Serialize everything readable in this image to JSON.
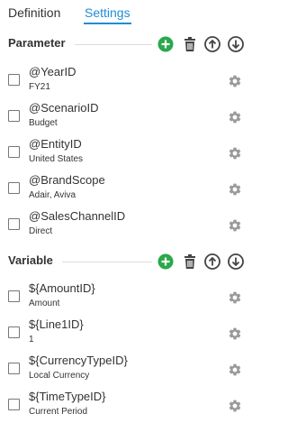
{
  "tabs": [
    {
      "label": "Definition",
      "active": false
    },
    {
      "label": "Settings",
      "active": true
    }
  ],
  "sections": [
    {
      "title": "Parameter",
      "items": [
        {
          "name": "@YearID",
          "value": "FY21"
        },
        {
          "name": "@ScenarioID",
          "value": "Budget"
        },
        {
          "name": "@EntityID",
          "value": "United States"
        },
        {
          "name": "@BrandScope",
          "value": "Adair, Aviva"
        },
        {
          "name": "@SalesChannelID",
          "value": "Direct"
        }
      ]
    },
    {
      "title": "Variable",
      "items": [
        {
          "name": "${AmountID}",
          "value": "Amount"
        },
        {
          "name": "${Line1ID}",
          "value": "1"
        },
        {
          "name": "${CurrencyTypeID}",
          "value": "Local Currency"
        },
        {
          "name": "${TimeTypeID}",
          "value": "Current Period"
        }
      ]
    }
  ],
  "icons": {
    "add": "add-circle-icon",
    "delete": "trash-icon",
    "move_up": "arrow-up-circle-icon",
    "move_down": "arrow-down-circle-icon",
    "settings": "gear-icon"
  },
  "colors": {
    "accent": "#1f8dd6",
    "add_green": "#2aa84a",
    "icon_dark": "#444444",
    "gear_gray": "#9a9a9a"
  }
}
